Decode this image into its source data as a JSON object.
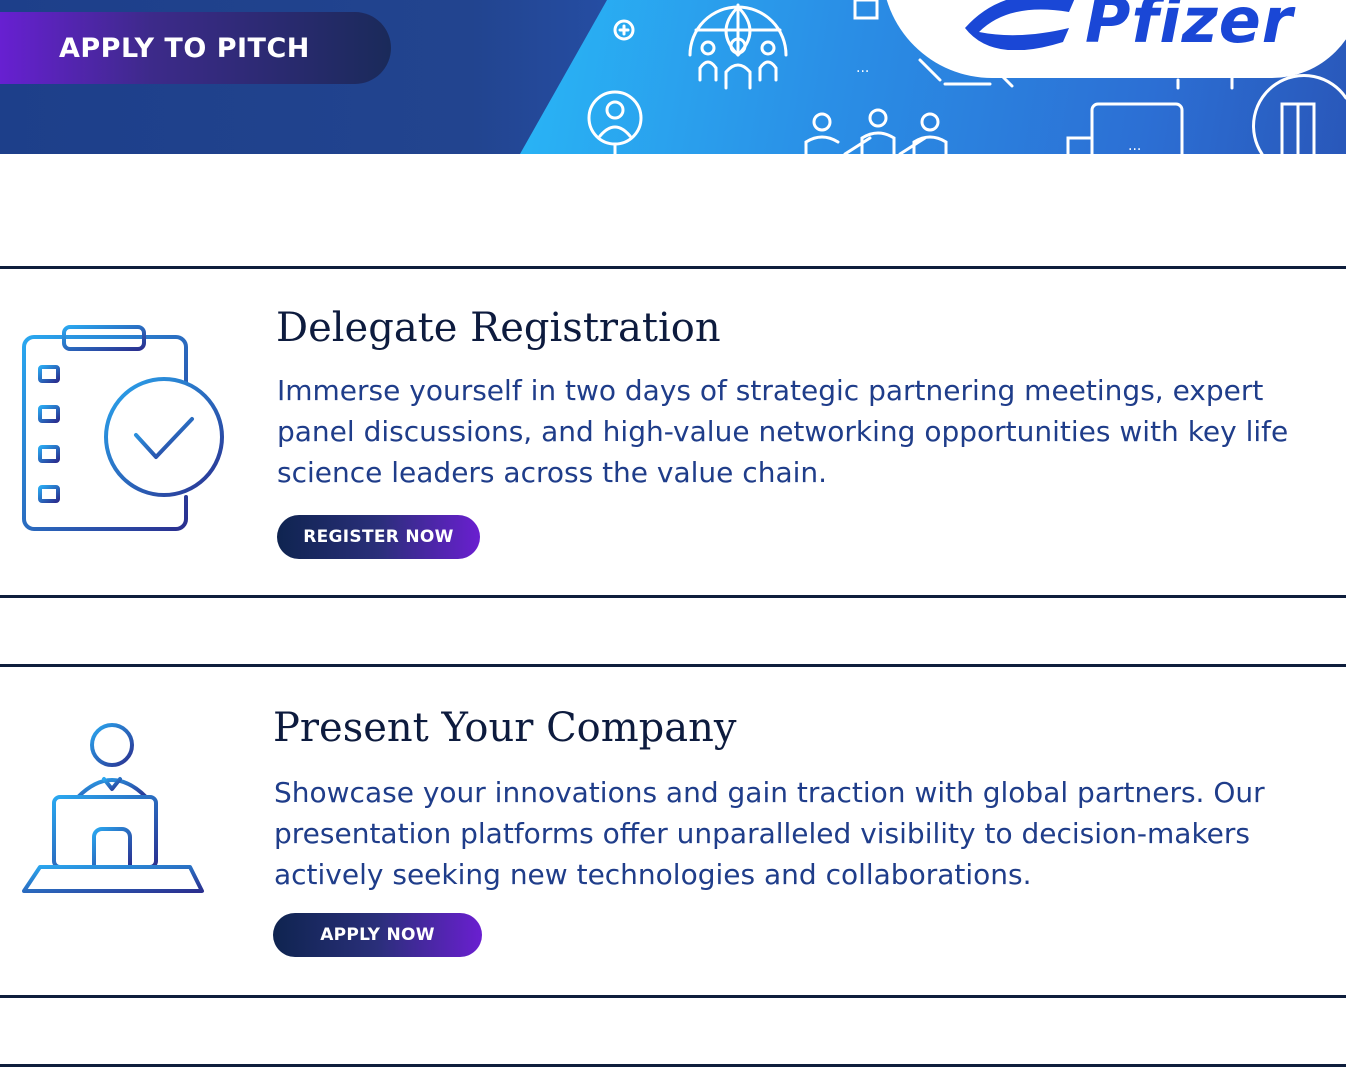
{
  "hero": {
    "apply_label": "APPLY TO PITCH",
    "logo_text": "Pfizer"
  },
  "cards": [
    {
      "title": "Delegate Registration",
      "description": "Immerse yourself in two days of strategic partnering meetings, expert panel discussions, and high-value networking opportunities with key life science leaders across the value chain.",
      "cta_label": "REGISTER NOW",
      "icon": "clipboard-check-icon"
    },
    {
      "title": "Present Your Company",
      "description": "Showcase your innovations and gain traction with global partners. Our presentation platforms offer unparalleled visibility to decision-makers actively seeking new technologies and collaborations.",
      "cta_label": "APPLY NOW",
      "icon": "presenter-laptop-icon"
    }
  ],
  "colors": {
    "navy": "#0f1e3c",
    "accent_blue": "#1a47d6",
    "accent_purple": "#6a1fd0",
    "text_blue": "#1f3d8a"
  }
}
